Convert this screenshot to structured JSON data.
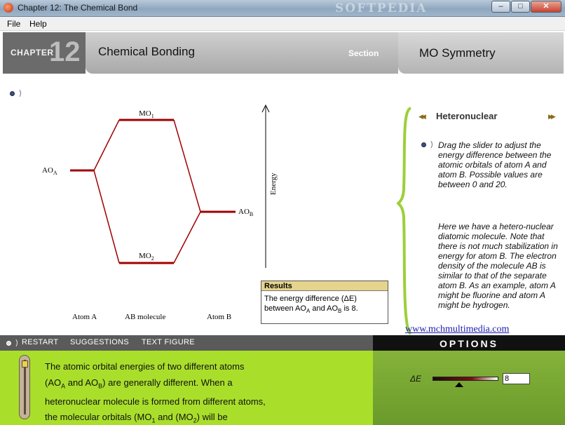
{
  "window": {
    "title": "Chapter 12: The Chemical Bond",
    "watermark": "SOFTPEDIA",
    "minimize": "–",
    "maximize": "□",
    "close": "✕"
  },
  "menu": {
    "file": "File",
    "help": "Help"
  },
  "header": {
    "chapter_label": "CHAPTER",
    "chapter_number": "12",
    "topic": "Chemical Bonding",
    "section_label": "Section",
    "subtopic": "MO Symmetry"
  },
  "diagram": {
    "mo1": "MO",
    "mo1_sub": "1",
    "mo2": "MO",
    "mo2_sub": "2",
    "aoa": "AO",
    "aoa_sub": "A",
    "aob": "AO",
    "aob_sub": "B",
    "energy": "Energy",
    "atom_a": "Atom A",
    "ab_molecule": "AB molecule",
    "atom_b": "Atom B",
    "line_color": "#a00000"
  },
  "results": {
    "header": "Results",
    "line1": "The energy difference (ΔE)",
    "line2_pre": "between AO",
    "line2_sub1": "A",
    "line2_mid": " and AO",
    "line2_sub2": "B",
    "line2_post": " is 8."
  },
  "panel": {
    "title": "Heteronuclear",
    "prev": "◀◀",
    "next": "▶▶",
    "para1": "Drag the slider to adjust the energy difference between the atomic orbitals of atom A and atom B. Possible values are between 0 and 20.",
    "para2": "Here we have a hetero-nuclear diatomic molecule. Note that there is not much stabilization in energy for atom B.  The electron density of the molecule AB is similar to that of the separate atom B.  As an example, atom A might be fluorine and atom A might be hydrogen.",
    "link": "www.mchmultimedia.com"
  },
  "toolbar": {
    "restart": "RESTART",
    "suggestions": "SUGGESTIONS",
    "text_figure": "TEXT FIGURE",
    "options": "OPTIONS"
  },
  "bottom_text": {
    "l1": "The atomic orbital energies of two different atoms",
    "l2a": "(AO",
    "l2sa": "A",
    "l2b": " and AO",
    "l2sb": "B",
    "l2c": ") are generally different. When a",
    "l3": "heteronuclear molecule is formed from different atoms,",
    "l4a": "the molecular orbitals (MO",
    "l4sa": "1",
    "l4b": " and (MO",
    "l4sb": "2",
    "l4c": ")  will be"
  },
  "options": {
    "delta_e_label": "ΔE",
    "delta_e_value": "8",
    "delta_e_min": 0,
    "delta_e_max": 20
  },
  "colors": {
    "green": "#a9df2b",
    "dark_green": "#6a9a2b",
    "orbital_line": "#a00000",
    "results_header": "#e6d48c"
  }
}
